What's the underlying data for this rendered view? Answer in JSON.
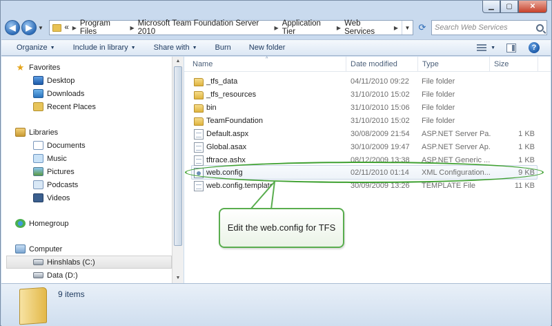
{
  "window": {
    "caption": {
      "minimize": "▁",
      "maximize": "▢",
      "close": "✕"
    }
  },
  "address": {
    "overflow": "«",
    "crumbs": [
      "Program Files",
      "Microsoft Team Foundation Server 2010",
      "Application Tier",
      "Web Services"
    ],
    "search_placeholder": "Search Web Services"
  },
  "toolbar": {
    "organize": "Organize",
    "include_in_library": "Include in library",
    "share_with": "Share with",
    "burn": "Burn",
    "new_folder": "New folder"
  },
  "nav": {
    "favorites": {
      "label": "Favorites",
      "items": [
        "Desktop",
        "Downloads",
        "Recent Places"
      ]
    },
    "libraries": {
      "label": "Libraries",
      "items": [
        "Documents",
        "Music",
        "Pictures",
        "Podcasts",
        "Videos"
      ]
    },
    "homegroup": "Homegroup",
    "computer": {
      "label": "Computer",
      "items": [
        "Hinshlabs (C:)",
        "Data (D:)"
      ]
    }
  },
  "columns": {
    "name": "Name",
    "date": "Date modified",
    "type": "Type",
    "size": "Size"
  },
  "files": [
    {
      "name": "_tfs_data",
      "date": "04/11/2010 09:22",
      "type": "File folder",
      "size": "",
      "icon": "folder"
    },
    {
      "name": "_tfs_resources",
      "date": "31/10/2010 15:02",
      "type": "File folder",
      "size": "",
      "icon": "folder"
    },
    {
      "name": "bin",
      "date": "31/10/2010 15:06",
      "type": "File folder",
      "size": "",
      "icon": "folder"
    },
    {
      "name": "TeamFoundation",
      "date": "31/10/2010 15:02",
      "type": "File folder",
      "size": "",
      "icon": "folder"
    },
    {
      "name": "Default.aspx",
      "date": "30/08/2009 21:54",
      "type": "ASP.NET Server Pa...",
      "size": "1 KB",
      "icon": "page"
    },
    {
      "name": "Global.asax",
      "date": "30/10/2009 19:47",
      "type": "ASP.NET Server Ap...",
      "size": "1 KB",
      "icon": "page"
    },
    {
      "name": "tftrace.ashx",
      "date": "08/12/2009 13:38",
      "type": "ASP.NET Generic ...",
      "size": "1 KB",
      "icon": "page"
    },
    {
      "name": "web.config",
      "date": "02/11/2010 01:14",
      "type": "XML Configuration...",
      "size": "9 KB",
      "icon": "config"
    },
    {
      "name": "web.config.template",
      "date": "30/09/2009 13:26",
      "type": "TEMPLATE File",
      "size": "11 KB",
      "icon": "page"
    }
  ],
  "selected_file": "web.config",
  "annotation": {
    "text": "Edit the web.config for TFS",
    "color": "#3ea030"
  },
  "status": {
    "count": "9 items"
  }
}
